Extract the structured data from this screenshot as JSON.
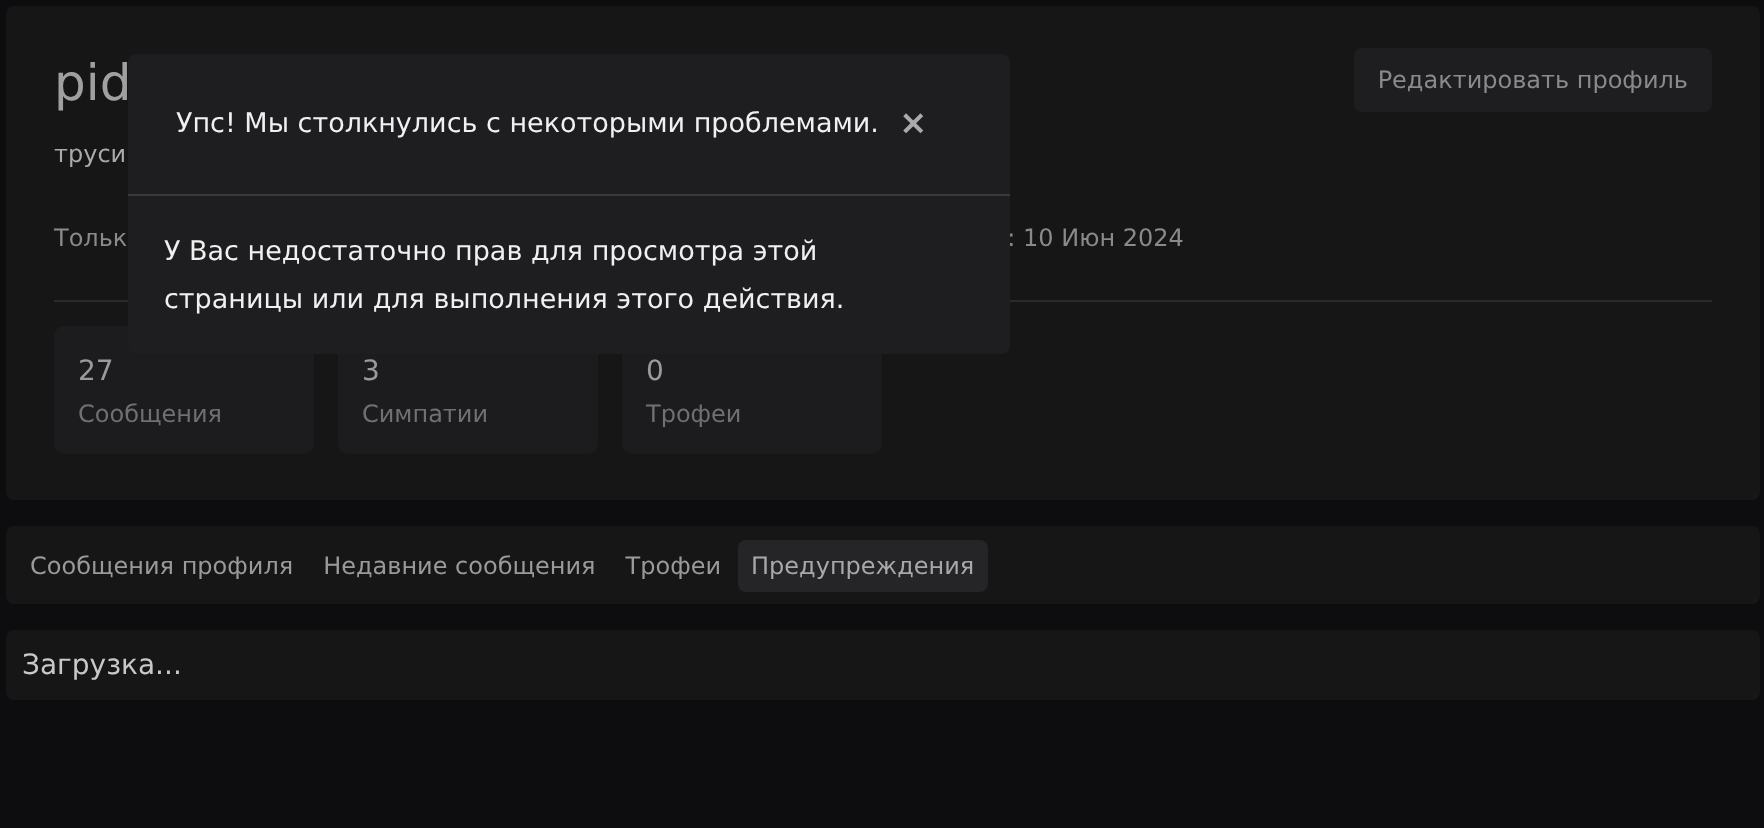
{
  "profile": {
    "name": "pid",
    "subtitle": "труси",
    "info_left": "Тольк",
    "info_right": ": 10 Июн 2024",
    "edit_button": "Редактировать профиль",
    "stats": [
      {
        "value": "27",
        "label": "Сообщения"
      },
      {
        "value": "3",
        "label": "Симпатии"
      },
      {
        "value": "0",
        "label": "Трофеи"
      }
    ]
  },
  "tabs": [
    {
      "label": "Сообщения профиля",
      "selected": false
    },
    {
      "label": "Недавние сообщения",
      "selected": false
    },
    {
      "label": "Трофеи",
      "selected": false
    },
    {
      "label": "Предупреждения",
      "selected": true
    }
  ],
  "loading": "Загрузка...",
  "dialog": {
    "title": "Упс! Мы столкнулись с некоторыми проблемами.",
    "close": "×",
    "message": "У Вас недостаточно прав для просмотра этой страницы или для выполнения этого действия."
  }
}
